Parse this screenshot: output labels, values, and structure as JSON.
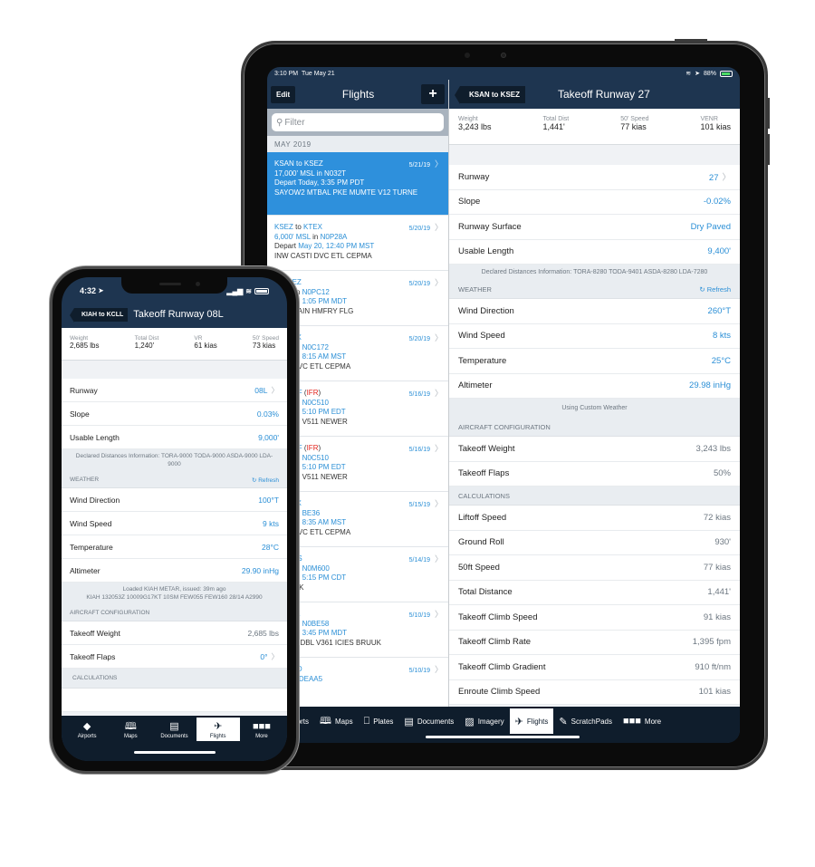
{
  "ipad": {
    "status": {
      "time": "3:10 PM",
      "date": "Tue May 21",
      "battery": "88%"
    },
    "flights_pane": {
      "edit_label": "Edit",
      "title": "Flights",
      "add_label": "+",
      "filter_placeholder": "Filter",
      "section": "MAY 2019",
      "flights": [
        {
          "from": "KSAN",
          "to": "KSEZ",
          "tag": "",
          "date": "5/21/19",
          "alt": "17,000' MSL",
          "aircraft": "N032T",
          "depart_prefix": "Depart",
          "depart": "Today, 3:35 PM PDT",
          "route": "SAYOW2 MTBAL PKE MUMTE V12 TURNE",
          "selected": true
        },
        {
          "from": "KSEZ",
          "to": "KTEX",
          "tag": "",
          "date": "5/20/19",
          "alt": "6,000' MSL",
          "aircraft": "N0P28A",
          "depart_prefix": "Depart",
          "depart": "May 20, 12:40 PM MST",
          "route": "INW CASTI DVC ETL CEPMA"
        },
        {
          "from": "",
          "to": "KSEZ",
          "tag": "",
          "date": "5/20/19",
          "alt": "' MSL",
          "aircraft": "N0PC12",
          "depart_prefix": "",
          "depart": "May 20, 1:05 PM MDT",
          "route": "128 LRAIN HMFRY FLG"
        },
        {
          "from": "",
          "to": "KTEX",
          "tag": "",
          "date": "5/20/19",
          "alt": "' MSL",
          "aircraft": "N0C172",
          "depart_prefix": "",
          "depart": "May 20, 8:15 AM MST",
          "route": "ASTI DVC ETL CEPMA"
        },
        {
          "from": "",
          "to": "KOPF",
          "tag": "IFR",
          "date": "5/16/19",
          "alt": "' MSL",
          "aircraft": "N0C510",
          "depart_prefix": "",
          "depart": "May 16, 5:10 PM EDT",
          "route": "N GILBI V511 NEWER"
        },
        {
          "from": "",
          "to": "KOPF",
          "tag": "IFR",
          "date": "5/16/19",
          "alt": "' MSL",
          "aircraft": "N0C510",
          "depart_prefix": "",
          "depart": "May 16, 5:10 PM EDT",
          "route": "N GILBI V511 NEWER"
        },
        {
          "from": "",
          "to": "KTEX",
          "tag": "",
          "date": "5/15/19",
          "alt": "' MSL",
          "aircraft": "BE36",
          "depart_prefix": "",
          "depart": "May 15, 8:35 AM MST",
          "route": "ASTI DVC ETL CEPMA"
        },
        {
          "from": "",
          "to": "KAUS",
          "tag": "",
          "date": "5/14/19",
          "alt": "' MSL",
          "aircraft": "N0M600",
          "depart_prefix": "",
          "depart": "May 14, 5:15 PM CDT",
          "route": "DU CWK"
        },
        {
          "from": "",
          "to": "KAJZ",
          "tag": "",
          "date": "5/10/19",
          "alt": "' MSL",
          "aircraft": "N0BE58",
          "depart_prefix": "",
          "depart": "May 10, 3:45 PM MDT",
          "route": "S V134 DBL V361 ICIES BRUUK"
        },
        {
          "from": "",
          "to": "EDTD",
          "tag": "",
          "date": "5/10/19",
          "alt": "MSL",
          "aircraft": "DEAA5",
          "depart_prefix": "",
          "depart": "",
          "route": ""
        }
      ]
    },
    "detail_pane": {
      "back_label": "KSAN to KSEZ",
      "title": "Takeoff Runway 27",
      "summary": [
        {
          "label": "Weight",
          "value": "3,243 lbs"
        },
        {
          "label": "Total Dist",
          "value": "1,441'"
        },
        {
          "label": "50' Speed",
          "value": "77 kias"
        },
        {
          "label": "VENR",
          "value": "101 kias"
        }
      ],
      "runway_rows": [
        {
          "label": "Runway",
          "value": "27",
          "chevron": true
        },
        {
          "label": "Slope",
          "value": "-0.02%"
        },
        {
          "label": "Runway Surface",
          "value": "Dry Paved"
        },
        {
          "label": "Usable Length",
          "value": "9,400'"
        }
      ],
      "declared_note": "Declared Distances Information:  TORA-8280  TODA-9401  ASDA-8280  LDA-7280",
      "weather_header": "WEATHER",
      "refresh_label": "Refresh",
      "weather_rows": [
        {
          "label": "Wind Direction",
          "value": "260°T"
        },
        {
          "label": "Wind Speed",
          "value": "8 kts"
        },
        {
          "label": "Temperature",
          "value": "25°C"
        },
        {
          "label": "Altimeter",
          "value": "29.98 inHg"
        }
      ],
      "weather_note": "Using Custom Weather",
      "config_header": "AIRCRAFT CONFIGURATION",
      "config_rows": [
        {
          "label": "Takeoff Weight",
          "value": "3,243 lbs"
        },
        {
          "label": "Takeoff Flaps",
          "value": "50%"
        }
      ],
      "calc_header": "CALCULATIONS",
      "calc_rows": [
        {
          "label": "Liftoff Speed",
          "value": "72 kias"
        },
        {
          "label": "Ground Roll",
          "value": "930'"
        },
        {
          "label": "50ft Speed",
          "value": "77 kias"
        },
        {
          "label": "Total Distance",
          "value": "1,441'"
        },
        {
          "label": "Takeoff Climb Speed",
          "value": "91 kias"
        },
        {
          "label": "Takeoff Climb Rate",
          "value": "1,395 fpm"
        },
        {
          "label": "Takeoff Climb Gradient",
          "value": "910 ft/nm"
        },
        {
          "label": "Enroute Climb Speed",
          "value": "101 kias"
        }
      ]
    },
    "tabs": [
      {
        "label": "Airports",
        "icon": "airport-icon",
        "glyph": "◆"
      },
      {
        "label": "Maps",
        "icon": "map-icon",
        "glyph": "🕮"
      },
      {
        "label": "Plates",
        "icon": "plates-icon",
        "glyph": "⎕"
      },
      {
        "label": "Documents",
        "icon": "documents-icon",
        "glyph": "▤"
      },
      {
        "label": "Imagery",
        "icon": "imagery-icon",
        "glyph": "▨"
      },
      {
        "label": "Flights",
        "icon": "flights-icon",
        "glyph": "✈",
        "active": true
      },
      {
        "label": "ScratchPads",
        "icon": "pencil-icon",
        "glyph": "✎"
      },
      {
        "label": "More",
        "icon": "more-icon",
        "glyph": "■■■"
      }
    ]
  },
  "iphone": {
    "status": {
      "time": "4:32"
    },
    "back_label": "KIAH to KCLL",
    "title": "Takeoff Runway 08L",
    "summary": [
      {
        "label": "Weight",
        "value": "2,685 lbs"
      },
      {
        "label": "Total Dist",
        "value": "1,240'"
      },
      {
        "label": "VR",
        "value": "61 kias"
      },
      {
        "label": "50' Speed",
        "value": "73 kias"
      }
    ],
    "runway_rows": [
      {
        "label": "Runway",
        "value": "08L",
        "chevron": true
      },
      {
        "label": "Slope",
        "value": "0.03%"
      },
      {
        "label": "Usable Length",
        "value": "9,000'"
      }
    ],
    "declared_note": "Declared Distances Information:  TORA-9000  TODA-9000  ASDA-9000  LDA-9000",
    "weather_header": "WEATHER",
    "refresh_label": "Refresh",
    "weather_rows": [
      {
        "label": "Wind Direction",
        "value": "100°T"
      },
      {
        "label": "Wind Speed",
        "value": "9 kts"
      },
      {
        "label": "Temperature",
        "value": "28°C"
      },
      {
        "label": "Altimeter",
        "value": "29.90 inHg"
      }
    ],
    "metar_note_1": "Loaded KIAH METAR, issued: 39m ago",
    "metar_note_2": "KIAH 132053Z 10009G17KT 10SM FEW055 FEW160 28/14 A2990",
    "config_header": "AIRCRAFT CONFIGURATION",
    "config_rows": [
      {
        "label": "Takeoff Weight",
        "value": "2,685 lbs"
      },
      {
        "label": "Takeoff Flaps",
        "value": "0°",
        "chevron": true
      }
    ],
    "calc_header": "CALCULATIONS",
    "tabs": [
      {
        "label": "Airports",
        "icon": "airport-icon",
        "glyph": "◆"
      },
      {
        "label": "Maps",
        "icon": "map-icon",
        "glyph": "🕮"
      },
      {
        "label": "Documents",
        "icon": "documents-icon",
        "glyph": "▤"
      },
      {
        "label": "Flights",
        "icon": "flights-icon",
        "glyph": "✈",
        "active": true
      },
      {
        "label": "More",
        "icon": "more-icon",
        "glyph": "■■■"
      }
    ]
  }
}
